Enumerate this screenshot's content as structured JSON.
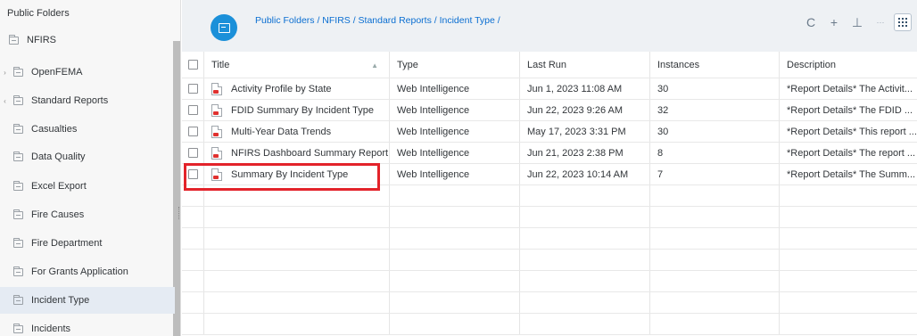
{
  "sidebar": {
    "items": [
      {
        "label": "Public Folders",
        "toggle": "",
        "icon": false
      },
      {
        "label": "NFIRS",
        "toggle": "",
        "icon": true
      },
      {
        "label": "OpenFEMA",
        "toggle": "›",
        "icon": true
      },
      {
        "label": "Standard Reports",
        "toggle": "‹",
        "icon": true
      },
      {
        "label": "Casualties",
        "toggle": "",
        "icon": true
      },
      {
        "label": "Data Quality",
        "toggle": "",
        "icon": true
      },
      {
        "label": "Excel Export",
        "toggle": "",
        "icon": true
      },
      {
        "label": "Fire Causes",
        "toggle": "",
        "icon": true
      },
      {
        "label": "Fire Department",
        "toggle": "",
        "icon": true
      },
      {
        "label": "For Grants Application",
        "toggle": "",
        "icon": true
      },
      {
        "label": "Incident Type",
        "toggle": "",
        "icon": true,
        "selected": true
      },
      {
        "label": "Incidents",
        "toggle": "",
        "icon": true
      }
    ]
  },
  "header": {
    "breadcrumb": "Public Folders / NFIRS / Standard Reports / Incident Type /",
    "actions": [
      {
        "name": "refresh-icon",
        "glyph": "C"
      },
      {
        "name": "add-icon",
        "glyph": "+"
      },
      {
        "name": "download-icon",
        "glyph": "⊥"
      },
      {
        "name": "more-icon",
        "glyph": "···"
      }
    ]
  },
  "table": {
    "columns": [
      "Title",
      "Type",
      "Last Run",
      "Instances",
      "Description"
    ],
    "rows": [
      [
        "Activity Profile by State",
        "Web Intelligence",
        "Jun 1, 2023 11:08 AM",
        "30",
        "*Report Details* The Activit..."
      ],
      [
        "FDID Summary By Incident Type",
        "Web Intelligence",
        "Jun 22, 2023 9:26 AM",
        "32",
        "*Report Details* The FDID ..."
      ],
      [
        "Multi-Year Data Trends",
        "Web Intelligence",
        "May 17, 2023 3:31 PM",
        "30",
        "*Report Details* This report ..."
      ],
      [
        "NFIRS Dashboard Summary Report",
        "Web Intelligence",
        "Jun 21, 2023 2:38 PM",
        "8",
        "*Report Details* The report ..."
      ],
      [
        "Summary By Incident Type",
        "Web Intelligence",
        "Jun 22, 2023 10:14 AM",
        "7",
        "*Report Details* The Summ..."
      ]
    ],
    "empty_rows": 7,
    "highlighted_row": 4
  },
  "colors": {
    "accent": "#1b90d9",
    "link": "#0a6ed1",
    "highlight": "#e3232a",
    "selected": "#e5ebf3"
  }
}
